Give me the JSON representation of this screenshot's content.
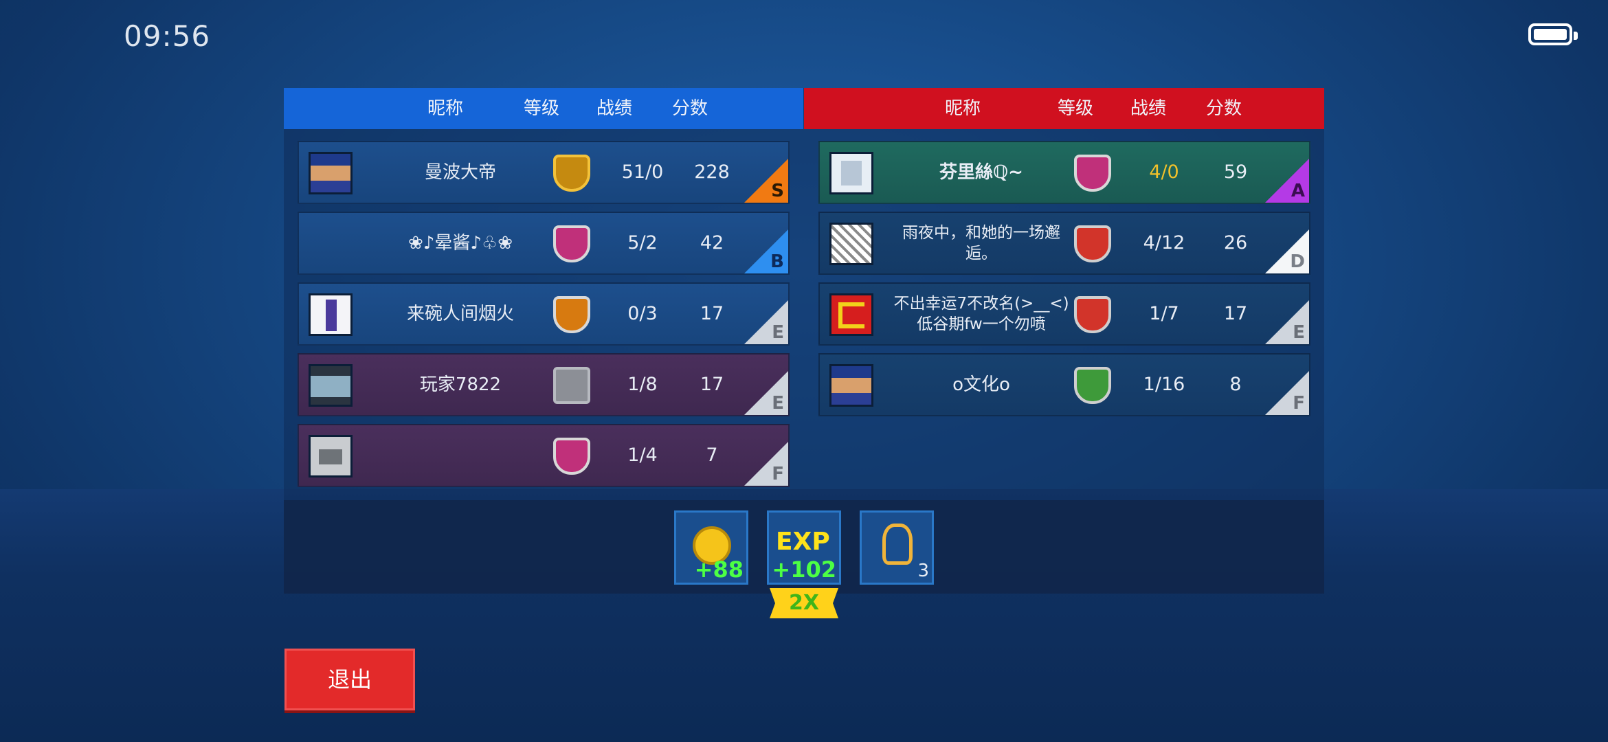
{
  "status_bar": {
    "time": "09:56"
  },
  "blue_team": {
    "headers": {
      "nickname": "昵称",
      "level": "等级",
      "record": "战绩",
      "score": "分数"
    },
    "players": [
      {
        "name": "曼波大帝",
        "record": "51/0",
        "score": "228",
        "grade": "S"
      },
      {
        "name": "❀♪晕酱♪♧❀",
        "record": "5/2",
        "score": "42",
        "grade": "B"
      },
      {
        "name": "来碗人间烟火",
        "record": "0/3",
        "score": "17",
        "grade": "E"
      },
      {
        "name": "玩家7822",
        "record": "1/8",
        "score": "17",
        "grade": "E"
      },
      {
        "name": "",
        "record": "1/4",
        "score": "7",
        "grade": "F"
      }
    ]
  },
  "red_team": {
    "headers": {
      "nickname": "昵称",
      "level": "等级",
      "record": "战绩",
      "score": "分数"
    },
    "players": [
      {
        "name": "芬里絲ℚ~",
        "record": "4/0",
        "score": "59",
        "grade": "A"
      },
      {
        "name": "雨夜中，和她的一场邂逅。",
        "record": "4/12",
        "score": "26",
        "grade": "D"
      },
      {
        "name": "不出幸运7不改名(>__<)低谷期fw一个勿喷",
        "record": "1/7",
        "score": "17",
        "grade": "E"
      },
      {
        "name": "o文化o",
        "record": "1/16",
        "score": "8",
        "grade": "F"
      }
    ]
  },
  "rewards": {
    "coins": "+88",
    "exp_label": "EXP",
    "exp": "+102",
    "multiplier": "2X",
    "keys": "3"
  },
  "exit_label": "退出"
}
